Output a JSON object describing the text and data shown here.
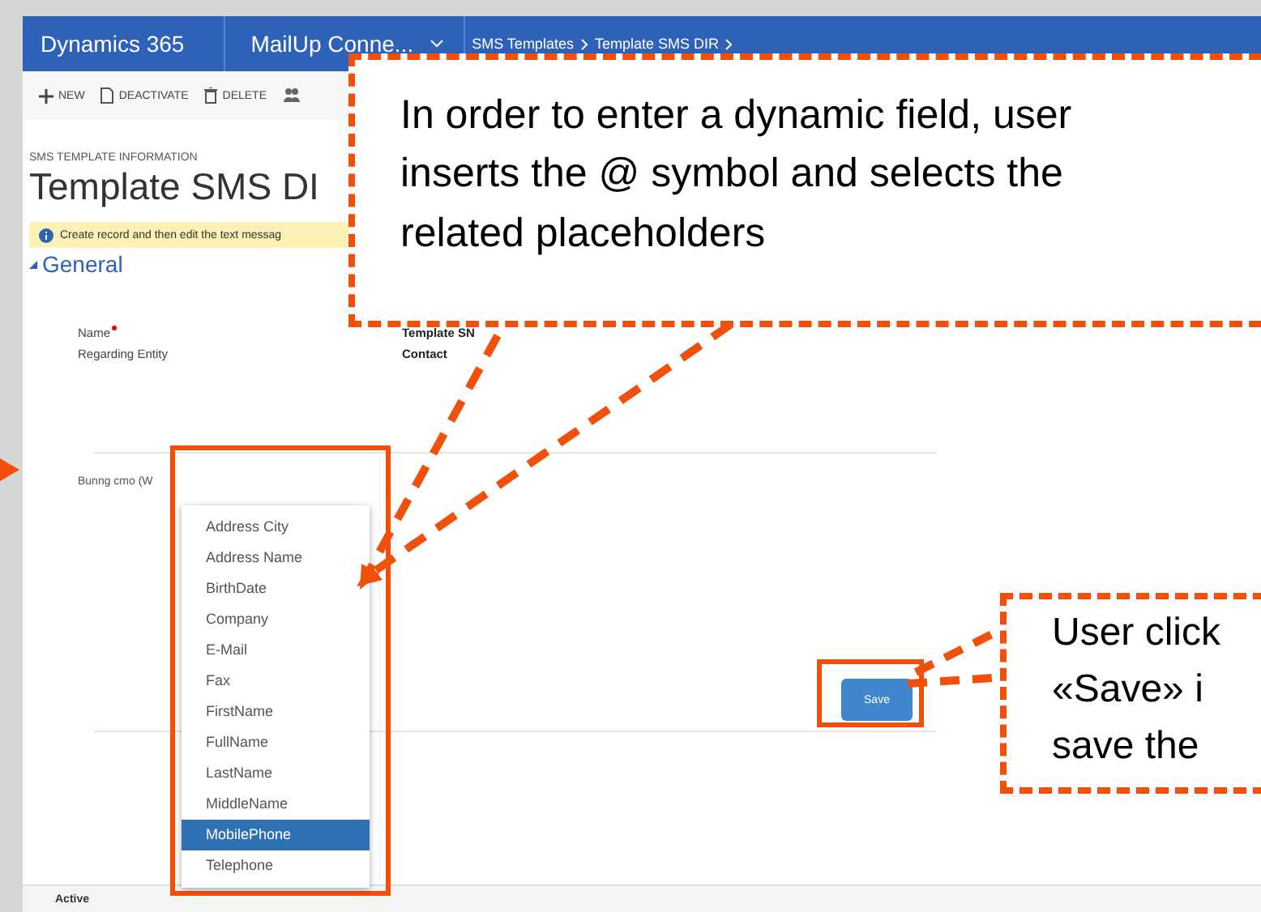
{
  "nav": {
    "product": "Dynamics 365",
    "app": "MailUp Conne...",
    "breadcrumbs": [
      "SMS Templates",
      "Template SMS DIR"
    ]
  },
  "toolbar": [
    {
      "kind": "new",
      "label": "NEW"
    },
    {
      "kind": "deactivate",
      "label": "DEACTIVATE"
    },
    {
      "kind": "delete",
      "label": "DELETE"
    },
    {
      "kind": "people"
    }
  ],
  "record": {
    "entity_label": "SMS TEMPLATE INFORMATION",
    "title": "Template SMS DI"
  },
  "notice": "Create record and then edit the text messag",
  "section": "General",
  "fields": [
    {
      "label": "Name",
      "required": true,
      "value": "Template SN"
    },
    {
      "label": "Regarding Entity",
      "required": false,
      "value": "Contact"
    }
  ],
  "body_field": {
    "label": "Bunng cmo (W"
  },
  "placeholder_menu": [
    {
      "label": "Address City",
      "selected": false
    },
    {
      "label": "Address Name",
      "selected": false
    },
    {
      "label": "BirthDate",
      "selected": false
    },
    {
      "label": "Company",
      "selected": false
    },
    {
      "label": "E-Mail",
      "selected": false
    },
    {
      "label": "Fax",
      "selected": false
    },
    {
      "label": "FirstName",
      "selected": false
    },
    {
      "label": "FullName",
      "selected": false
    },
    {
      "label": "LastName",
      "selected": false
    },
    {
      "label": "MiddleName",
      "selected": false
    },
    {
      "label": "MobilePhone",
      "selected": true
    },
    {
      "label": "Telephone",
      "selected": false
    }
  ],
  "save_button": "Save",
  "status": "Active",
  "callouts": [
    {
      "lines": [
        "In order to enter a dynamic field, user",
        "inserts the @ symbol and selects the",
        "related placeholders"
      ]
    },
    {
      "lines": [
        "User click",
        "«Save» i",
        "save the"
      ]
    }
  ]
}
